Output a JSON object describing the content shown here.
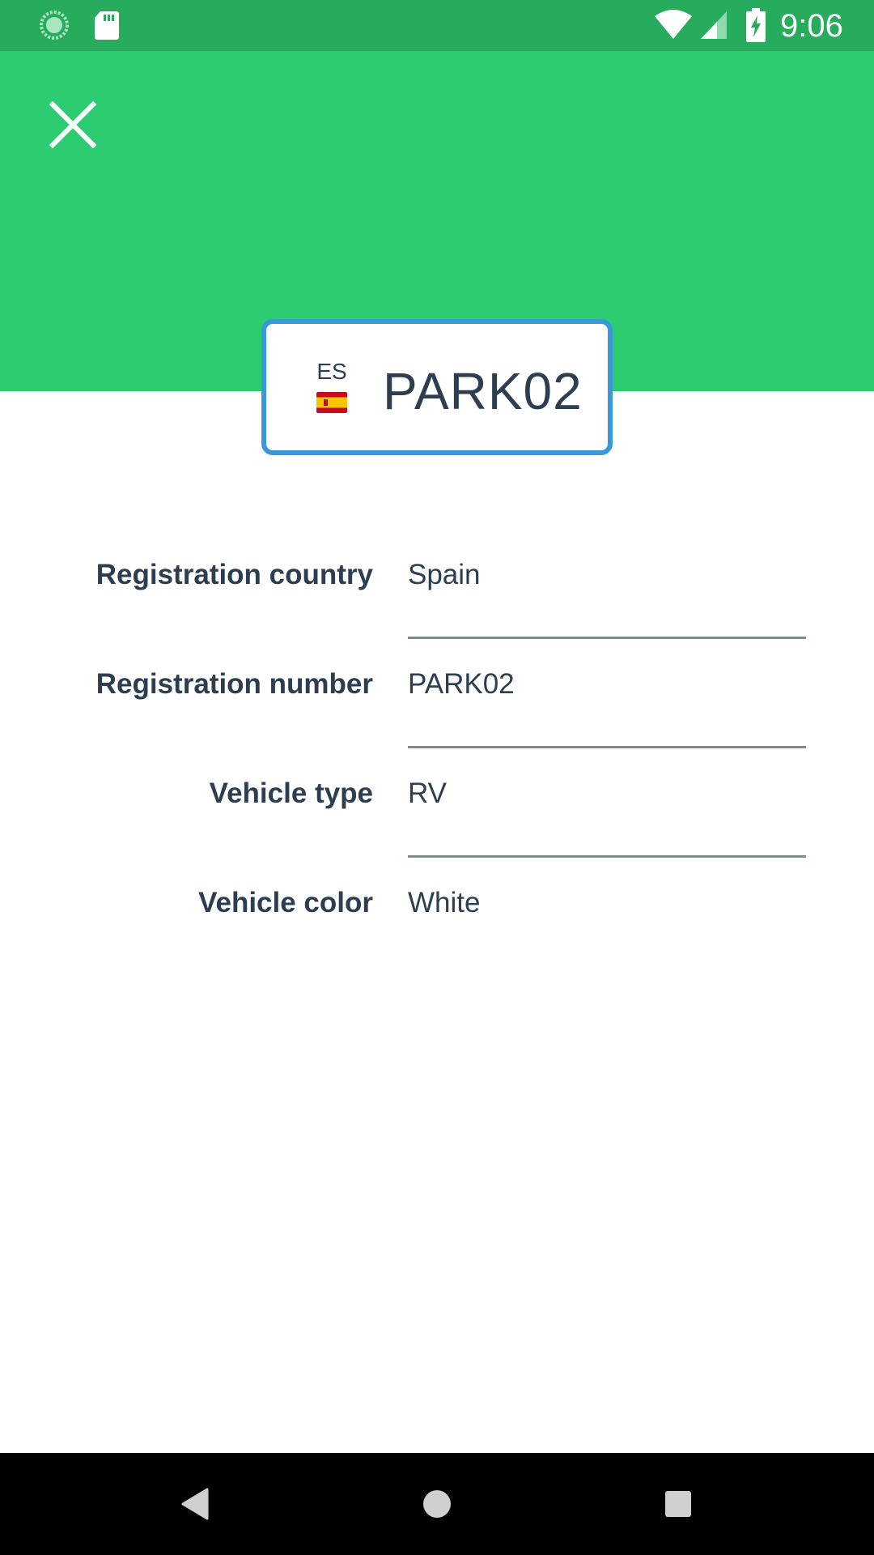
{
  "status_bar": {
    "time": "9:06",
    "icons": [
      "sync-icon",
      "sd-card-icon",
      "wifi-icon",
      "signal-icon",
      "battery-charging-icon"
    ]
  },
  "header": {
    "background_color": "#2ecc71",
    "close_icon": "close-icon"
  },
  "plate": {
    "country_code": "ES",
    "flag": "spain-flag-icon",
    "number": "PARK02",
    "border_color": "#3a98da"
  },
  "form": {
    "fields": [
      {
        "label": "Registration country",
        "value": "Spain"
      },
      {
        "label": "Registration number",
        "value": "PARK02"
      },
      {
        "label": "Vehicle type",
        "value": "RV"
      },
      {
        "label": "Vehicle color",
        "value": "White"
      }
    ]
  },
  "nav_bar": {
    "buttons": [
      "back-icon",
      "home-icon",
      "recents-icon"
    ]
  },
  "colors": {
    "text": "#2c3e50",
    "status_bar": "#27ab5d",
    "divider": "#7f8c8d"
  }
}
